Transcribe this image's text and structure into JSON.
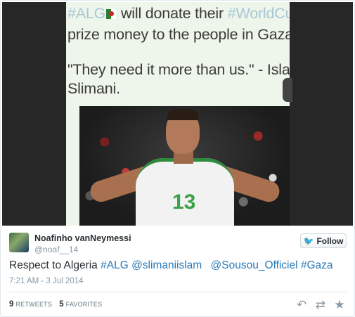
{
  "media": {
    "caption_lines": [
      {
        "hashtag_1": "#ALG",
        "text_1": " will donate their ",
        "hashtag_2": "#WorldCup"
      },
      {
        "text": "prize money to the people in Gaza."
      },
      {
        "text": "\"They need it more than us.\" - Islam"
      },
      {
        "text": "Slimani."
      }
    ],
    "jersey_number": "13"
  },
  "author": {
    "fullname": "Noafinho vanNeymessi",
    "username": "@noaf__14"
  },
  "follow_button": {
    "label": "Follow",
    "icon": "twitter-bird-icon"
  },
  "tweet": {
    "text_prefix": "Respect to Algeria ",
    "hashtag_alg": "#ALG",
    "mention_1": "@slimaniislam",
    "mention_2": "@Sousou_Officiel",
    "hashtag_gaza": "#Gaza",
    "timestamp": "7:21 AM - 3 Jul 2014"
  },
  "stats": {
    "retweets_count": "9",
    "retweets_label": "RETWEETS",
    "favorites_count": "5",
    "favorites_label": "FAVORITES"
  },
  "actions": {
    "reply_icon": "reply-icon",
    "retweet_icon": "retweet-icon",
    "favorite_icon": "star-icon"
  },
  "colors": {
    "link": "#2b7bb9",
    "follow_bird": "#55acee",
    "muted": "#8899a6"
  }
}
